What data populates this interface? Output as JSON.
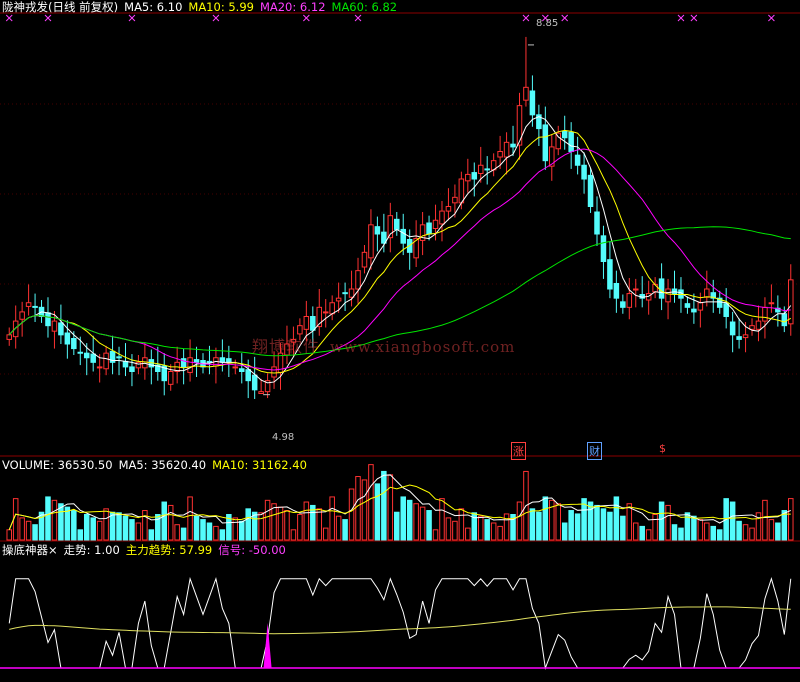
{
  "header": {
    "title": "陇神戎发(日线 前复权)",
    "ma5": "MA5: 6.10",
    "ma10": "MA10: 5.99",
    "ma20": "MA20: 6.12",
    "ma60": "MA60: 6.82"
  },
  "annotations": {
    "high": "8.85",
    "low": "4.98",
    "tag1": "涨",
    "tag2": "财",
    "tag3": "$"
  },
  "volume_header": {
    "volume": "VOLUME: 36530.50",
    "ma5": "MA5: 35620.40",
    "ma10": "MA10: 31162.40"
  },
  "indicator_header": {
    "name": "操底神器×",
    "trend": "走势: 1.00",
    "main": "主力趋势: 57.99",
    "signal": "信号: -50.00"
  },
  "watermark": {
    "cn": "翔博软件",
    "url": "www.xiangbosoft.com"
  },
  "colors": {
    "up": "#ff3232",
    "down": "#54fcfc",
    "ma5": "#ffffff",
    "ma10": "#ffff00",
    "ma20": "#ff00ff",
    "ma60": "#00e600",
    "trend": "#ffffff",
    "main": "#e0e060",
    "signal": "#ff00ff",
    "grid": "#8b0000"
  },
  "chart_data": {
    "type": "candlestick",
    "price_ylim": [
      4.3,
      9.1
    ],
    "closes": [
      5.6,
      5.75,
      5.85,
      5.95,
      5.9,
      5.8,
      5.7,
      5.75,
      5.6,
      5.5,
      5.45,
      5.4,
      5.35,
      5.3,
      5.25,
      5.4,
      5.3,
      5.35,
      5.25,
      5.2,
      5.3,
      5.35,
      5.25,
      5.2,
      5.1,
      5.2,
      5.3,
      5.25,
      5.35,
      5.3,
      5.25,
      5.3,
      5.35,
      5.3,
      5.3,
      5.25,
      5.2,
      5.1,
      5.0,
      4.98,
      5.1,
      5.25,
      5.4,
      5.5,
      5.55,
      5.7,
      5.8,
      5.65,
      5.9,
      5.85,
      5.95,
      6.0,
      6.05,
      6.1,
      6.3,
      6.5,
      6.8,
      6.7,
      6.6,
      6.9,
      6.75,
      6.6,
      6.5,
      6.65,
      6.8,
      6.7,
      6.85,
      6.95,
      7.0,
      7.1,
      7.3,
      7.35,
      7.3,
      7.45,
      7.4,
      7.5,
      7.6,
      7.7,
      7.65,
      8.1,
      8.3,
      8.0,
      7.85,
      7.5,
      7.65,
      7.8,
      7.75,
      7.6,
      7.45,
      7.3,
      7.0,
      6.7,
      6.4,
      6.1,
      6.0,
      5.9,
      6.05,
      6.1,
      6.0,
      6.05,
      6.15,
      6.0,
      6.1,
      6.05,
      6.0,
      5.9,
      5.85,
      5.95,
      6.1,
      6.0,
      5.9,
      5.8,
      5.6,
      5.55,
      5.6,
      5.7,
      5.75,
      5.9,
      5.95,
      5.85,
      5.7,
      6.2
    ],
    "ma_values": {
      "ma5": 6.1,
      "ma10": 5.99,
      "ma20": 6.12,
      "ma60": 6.82
    },
    "high": 8.85,
    "low": 4.98,
    "volume_ylim": [
      0,
      60000
    ],
    "volume": {
      "last": 36530.5,
      "ma5": 35620.4,
      "ma10": 31162.4
    },
    "indicator": {
      "trend": 1.0,
      "main": 57.99,
      "signal": -50.0
    },
    "grid": true
  }
}
